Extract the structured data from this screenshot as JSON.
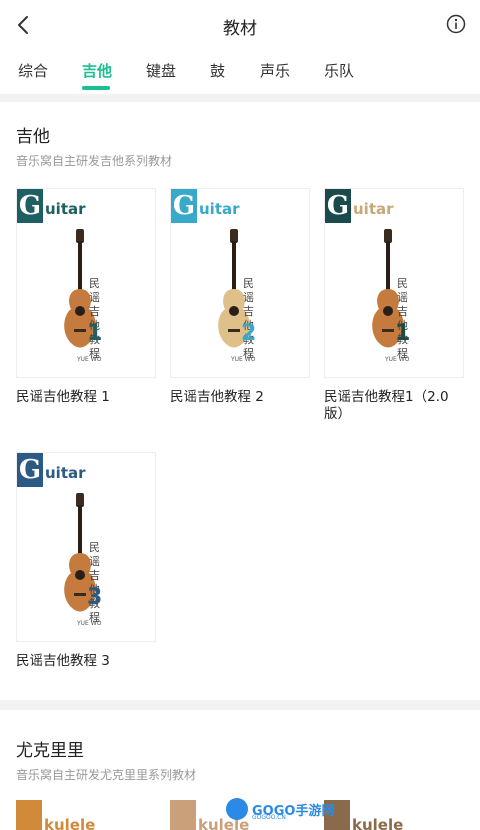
{
  "header": {
    "title": "教材"
  },
  "tabs": [
    {
      "label": "综合"
    },
    {
      "label": "吉他"
    },
    {
      "label": "键盘"
    },
    {
      "label": "鼓"
    },
    {
      "label": "声乐"
    },
    {
      "label": "乐队"
    }
  ],
  "active_tab": "吉他",
  "sections": [
    {
      "title": "吉他",
      "subtitle": "音乐窝自主研发吉他系列教材",
      "books": [
        {
          "label": "民谣吉他教程 1",
          "cover_word": "Guitar",
          "cover_text": "民谣吉他教程",
          "cover_num": "1",
          "accent": "#1d5f62"
        },
        {
          "label": "民谣吉他教程 2",
          "cover_word": "Guitar",
          "cover_text": "民谣吉他教程",
          "cover_num": "2",
          "accent": "#39a9c9"
        },
        {
          "label": "民谣吉他教程1（2.0版）",
          "cover_word": "Guitar",
          "cover_text": "民谣吉他教程",
          "cover_num": "1",
          "accent": "#1b4a4c",
          "word_color": "#c8a878"
        },
        {
          "label": "民谣吉他教程 3",
          "cover_word": "Guitar",
          "cover_text": "民谣吉他教程",
          "cover_num": "3",
          "accent": "#2b5a84"
        }
      ]
    },
    {
      "title": "尤克里里",
      "subtitle": "音乐窝自主研发尤克里里系列教材",
      "books": [
        {
          "cover_word": "Ukulele",
          "accent": "#d08a3a"
        },
        {
          "cover_word": "Ukulele",
          "accent": "#c9a07a"
        },
        {
          "cover_word": "Ukulele",
          "accent": "#8a6a4a"
        }
      ]
    }
  ],
  "cover_publisher": "YUE WO",
  "watermark": {
    "brand": "GOGO手游网",
    "domain": "GOGOO.CN"
  },
  "icons": {
    "back": "back-chevron-icon",
    "info": "info-icon",
    "guitar": "guitar-illustration"
  },
  "colors": {
    "accent": "#1cbf90",
    "background": "#f2f2f4"
  }
}
